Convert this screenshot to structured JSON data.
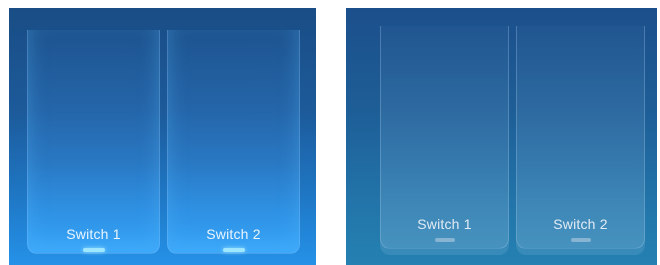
{
  "panels": [
    {
      "state_name": "on",
      "switches": [
        {
          "label": "Switch 1",
          "indicator": "on"
        },
        {
          "label": "Switch 2",
          "indicator": "on"
        }
      ]
    },
    {
      "state_name": "off",
      "switches": [
        {
          "label": "Switch 1",
          "indicator": "off"
        },
        {
          "label": "Switch 2",
          "indicator": "off"
        }
      ]
    }
  ],
  "colors": {
    "indicator_on": "#9fe6ff",
    "indicator_off": "#bed2e4",
    "panel_on_bottom": "#2592e8",
    "panel_off_bottom": "#2581b2"
  }
}
